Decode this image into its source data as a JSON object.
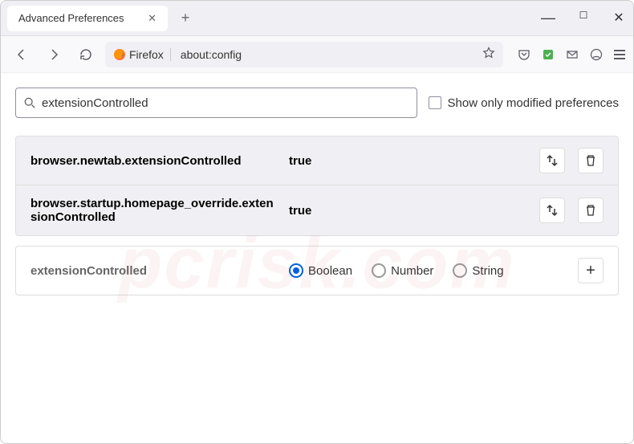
{
  "titlebar": {
    "tab_title": "Advanced Preferences"
  },
  "toolbar": {
    "firefox_label": "Firefox",
    "url": "about:config"
  },
  "search": {
    "value": "extensionControlled",
    "checkbox_label": "Show only modified preferences"
  },
  "prefs": [
    {
      "name": "browser.newtab.extensionControlled",
      "value": "true"
    },
    {
      "name": "browser.startup.homepage_override.extensionControlled",
      "value": "true"
    }
  ],
  "add": {
    "name": "extensionControlled",
    "types": [
      "Boolean",
      "Number",
      "String"
    ],
    "selected": "Boolean"
  },
  "watermark": "pcrisk.com"
}
